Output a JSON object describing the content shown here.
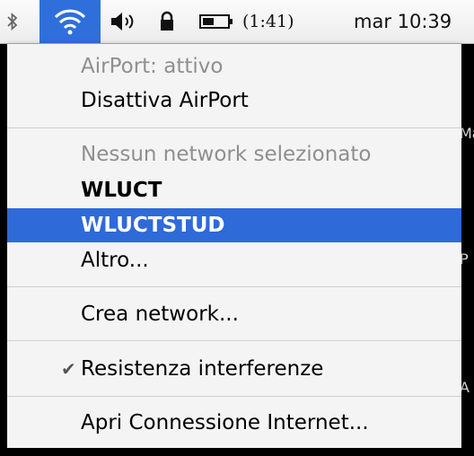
{
  "menubar": {
    "icons": [
      "bluetooth-icon",
      "wifi-icon",
      "volume-icon",
      "lock-icon",
      "battery-icon"
    ],
    "battery_time": "(1:41)",
    "clock": "mar 10:39"
  },
  "background_fragments": [
    "Mac",
    "P",
    "A"
  ],
  "menu": {
    "airport_status": "AirPort: attivo",
    "airport_toggle": "Disattiva AirPort",
    "no_network": "Nessun network selezionato",
    "networks": [
      "WLUCT",
      "WLUCTSTUD"
    ],
    "other": "Altro...",
    "create_network": "Crea network...",
    "interference": "Resistenza interferenze",
    "interference_checked": true,
    "open_internet_connect": "Apri Connessione Internet..."
  },
  "colors": {
    "highlight": "#2e6ad8",
    "wifi_active_bg": "#2f6fdc"
  }
}
